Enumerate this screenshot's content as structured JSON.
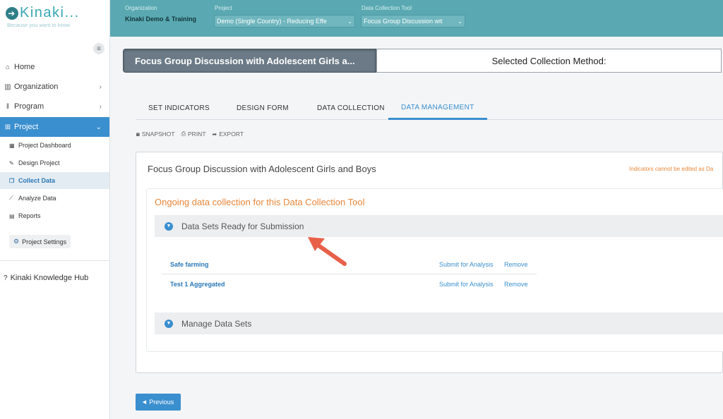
{
  "logo": {
    "name": "Kinaki...",
    "tagline": "Because you want to know",
    "icon": "circle-arrow-icon"
  },
  "topbar": {
    "organization_label": "Organization",
    "organization_value": "Kinaki Demo & Training",
    "project_label": "Project",
    "project_value": "Demo (Single Country) - Reducing Effe",
    "tool_label": "Data Collection Tool",
    "tool_value": "Focus Group Discussion wit"
  },
  "sidebar": {
    "items": [
      {
        "label": "Home",
        "icon": "home-icon"
      },
      {
        "label": "Organization",
        "icon": "building-icon"
      },
      {
        "label": "Program",
        "icon": "columns-icon"
      },
      {
        "label": "Project",
        "icon": "sitemap-icon"
      }
    ],
    "sub_items": [
      {
        "label": "Project Dashboard",
        "icon": "dashboard-icon"
      },
      {
        "label": "Design Project",
        "icon": "pencil-icon"
      },
      {
        "label": "Collect Data",
        "icon": "copy-icon"
      },
      {
        "label": "Analyze Data",
        "icon": "chart-icon"
      },
      {
        "label": "Reports",
        "icon": "file-icon"
      }
    ],
    "settings_label": "Project Settings",
    "knowledge_hub": "Kinaki Knowledge Hub"
  },
  "header": {
    "title": "Focus Group Discussion with Adolescent Girls a...",
    "method_label": "Selected Collection Method:"
  },
  "tabs": [
    "SET INDICATORS",
    "DESIGN FORM",
    "DATA COLLECTION",
    "DATA MANAGEMENT"
  ],
  "active_tab": "DATA MANAGEMENT",
  "actions": [
    "SNAPSHOT",
    "PRINT",
    "EXPORT"
  ],
  "panel": {
    "title": "Focus Group Discussion with Adolescent Girls and Boys",
    "note": "Indicators cannot be edited as Da",
    "ongoing": "Ongoing data collection for this Data Collection Tool",
    "section_ready": "Data Sets Ready for Submission",
    "section_manage": "Manage Data Sets",
    "datasets": [
      {
        "name": "Safe farming",
        "submit": "Submit for Analysis",
        "remove": "Remove"
      },
      {
        "name": "Test 1 Aggregated",
        "submit": "Submit for Analysis",
        "remove": "Remove"
      }
    ]
  },
  "previous_label": "Previous",
  "colors": {
    "teal": "#5aa9b2",
    "blue": "#3a8fcf",
    "orange": "#e8873a",
    "arrow": "#e8604a"
  }
}
